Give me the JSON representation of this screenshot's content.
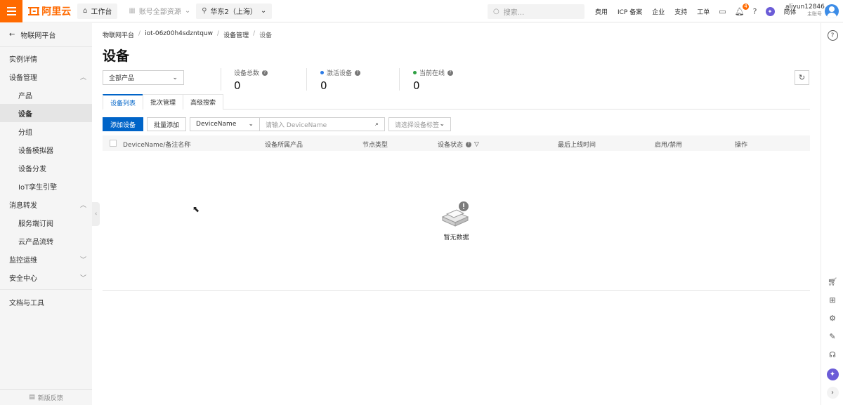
{
  "header": {
    "brand": "阿里云",
    "workbench": "工作台",
    "account_resources": "账号全部资源",
    "region": "华东2（上海）",
    "search_placeholder": "搜索...",
    "links": [
      "费用",
      "ICP 备案",
      "企业",
      "支持",
      "工单"
    ],
    "notification_count": "4",
    "language": "简体",
    "user_name": "aliyun12846...",
    "user_role": "主账号"
  },
  "sidebar": {
    "back_label": "物联网平台",
    "items": [
      {
        "label": "实例详情"
      },
      {
        "label": "设备管理"
      },
      {
        "label": "产品"
      },
      {
        "label": "设备"
      },
      {
        "label": "分组"
      },
      {
        "label": "设备模拟器"
      },
      {
        "label": "设备分发"
      },
      {
        "label": "IoT孪生引擎"
      },
      {
        "label": "消息转发"
      },
      {
        "label": "服务端订阅"
      },
      {
        "label": "云产品流转"
      },
      {
        "label": "监控运维"
      },
      {
        "label": "安全中心"
      },
      {
        "label": "文档与工具"
      }
    ],
    "feedback": "新版反馈"
  },
  "breadcrumb": [
    "物联网平台",
    "iot-06z00h4sdzntquw",
    "设备管理",
    "设备"
  ],
  "page_title": "设备",
  "product_filter": "全部产品",
  "stats": {
    "total": {
      "label": "设备总数",
      "value": "0"
    },
    "active": {
      "label": "激活设备",
      "value": "0"
    },
    "online": {
      "label": "当前在线",
      "value": "0"
    }
  },
  "colors": {
    "active_dot": "#2c7be5",
    "online_dot": "#2ea043",
    "primary": "#0064c8",
    "brand": "#ff6a00"
  },
  "tabs": [
    "设备列表",
    "批次管理",
    "高级搜索"
  ],
  "toolbar": {
    "add_device": "添加设备",
    "batch_add": "批量添加",
    "field_select": "DeviceName",
    "search_placeholder": "请输入 DeviceName",
    "tag_placeholder": "请选择设备标签"
  },
  "table": {
    "columns": [
      "DeviceName/备注名称",
      "设备所属产品",
      "节点类型",
      "设备状态",
      "最后上线时间",
      "启用/禁用",
      "操作"
    ],
    "rows": [],
    "empty_text": "暂无数据"
  }
}
